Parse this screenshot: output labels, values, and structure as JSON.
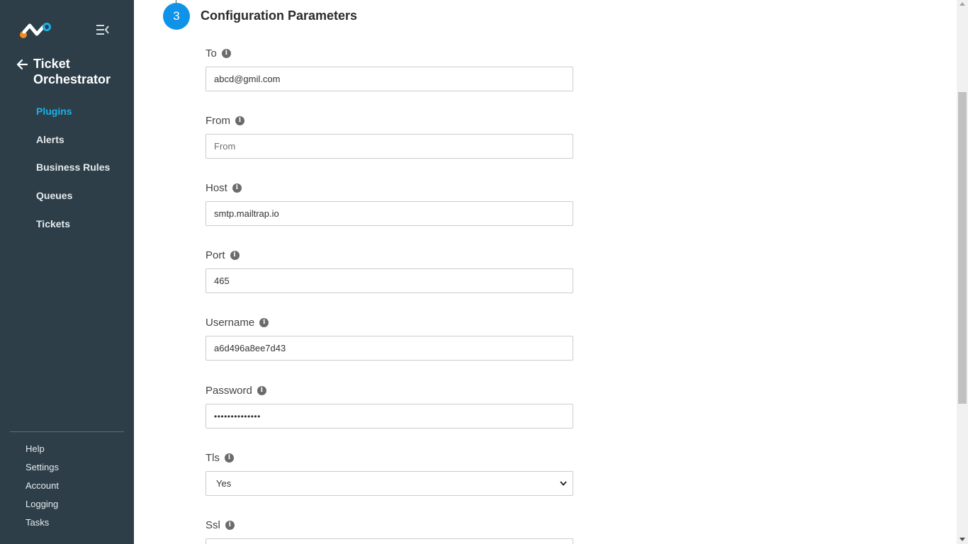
{
  "sidebar": {
    "app_title": "Ticket Orchestrator",
    "nav": [
      {
        "label": "Plugins",
        "active": true
      },
      {
        "label": "Alerts"
      },
      {
        "label": "Business Rules"
      },
      {
        "label": "Queues"
      },
      {
        "label": "Tickets"
      }
    ],
    "bottom_nav": [
      "Help",
      "Settings",
      "Account",
      "Logging",
      "Tasks"
    ]
  },
  "section": {
    "step_number": "3",
    "title": "Configuration Parameters"
  },
  "fields": {
    "to": {
      "label": "To",
      "value": "abcd@gmil.com"
    },
    "from": {
      "label": "From",
      "placeholder": "From"
    },
    "host": {
      "label": "Host",
      "value": "smtp.mailtrap.io"
    },
    "port": {
      "label": "Port",
      "value": "465"
    },
    "username": {
      "label": "Username",
      "value": "a6d496a8ee7d43"
    },
    "password": {
      "label": "Password",
      "value": "••••••••••••••"
    },
    "tls": {
      "label": "Tls",
      "value": "Yes"
    },
    "ssl": {
      "label": "Ssl"
    }
  },
  "icons": {
    "info": "i"
  },
  "colors": {
    "sidebar_bg": "#2d3e48",
    "accent": "#17b2e8",
    "step_circle": "#0f93e8"
  }
}
